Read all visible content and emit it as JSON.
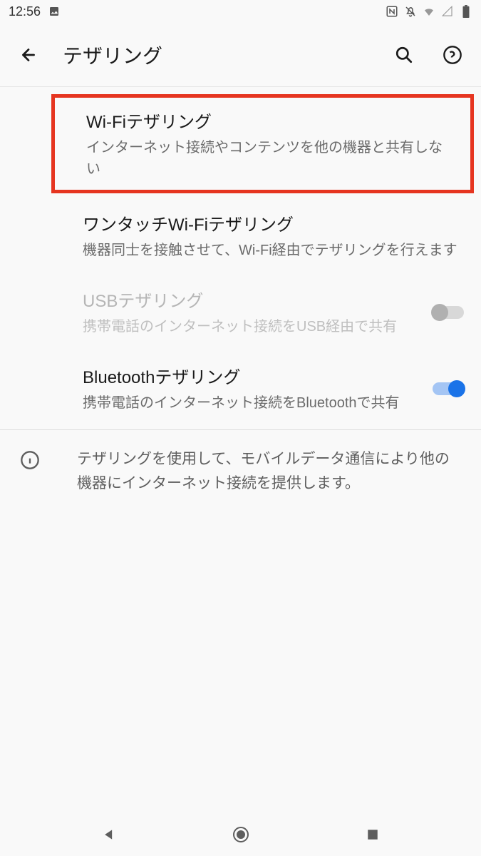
{
  "status": {
    "time": "12:56"
  },
  "header": {
    "title": "テザリング"
  },
  "items": [
    {
      "title": "Wi-Fiテザリング",
      "desc": "インターネット接続やコンテンツを他の機器と共有しない"
    },
    {
      "title": "ワンタッチWi-Fiテザリング",
      "desc": "機器同士を接触させて、Wi-Fi経由でテザリングを行えます"
    },
    {
      "title": "USBテザリング",
      "desc": "携帯電話のインターネット接続をUSB経由で共有"
    },
    {
      "title": "Bluetoothテザリング",
      "desc": "携帯電話のインターネット接続をBluetoothで共有"
    }
  ],
  "info": {
    "text": "テザリングを使用して、モバイルデータ通信により他の機器にインターネット接続を提供します。"
  }
}
